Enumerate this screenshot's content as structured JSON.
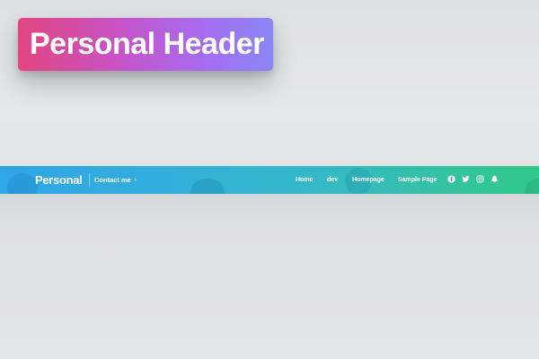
{
  "title_badge": {
    "text": "Personal Header"
  },
  "header": {
    "logo": "Personal",
    "contact_label": "Contact me",
    "contact_caret": "›",
    "nav": [
      "Home",
      "dev",
      "Homepage",
      "Sample Page"
    ],
    "social_icons": [
      "facebook-icon",
      "twitter-icon",
      "instagram-icon",
      "snapchat-icon"
    ]
  },
  "colors": {
    "page_background": "#e2e3e6",
    "header_gradient_start": "#2fa6e6",
    "header_gradient_end": "#2fc98a",
    "badge_gradient_start": "#e3457f",
    "badge_gradient_end": "#8a86f7",
    "text": "#ffffff"
  }
}
